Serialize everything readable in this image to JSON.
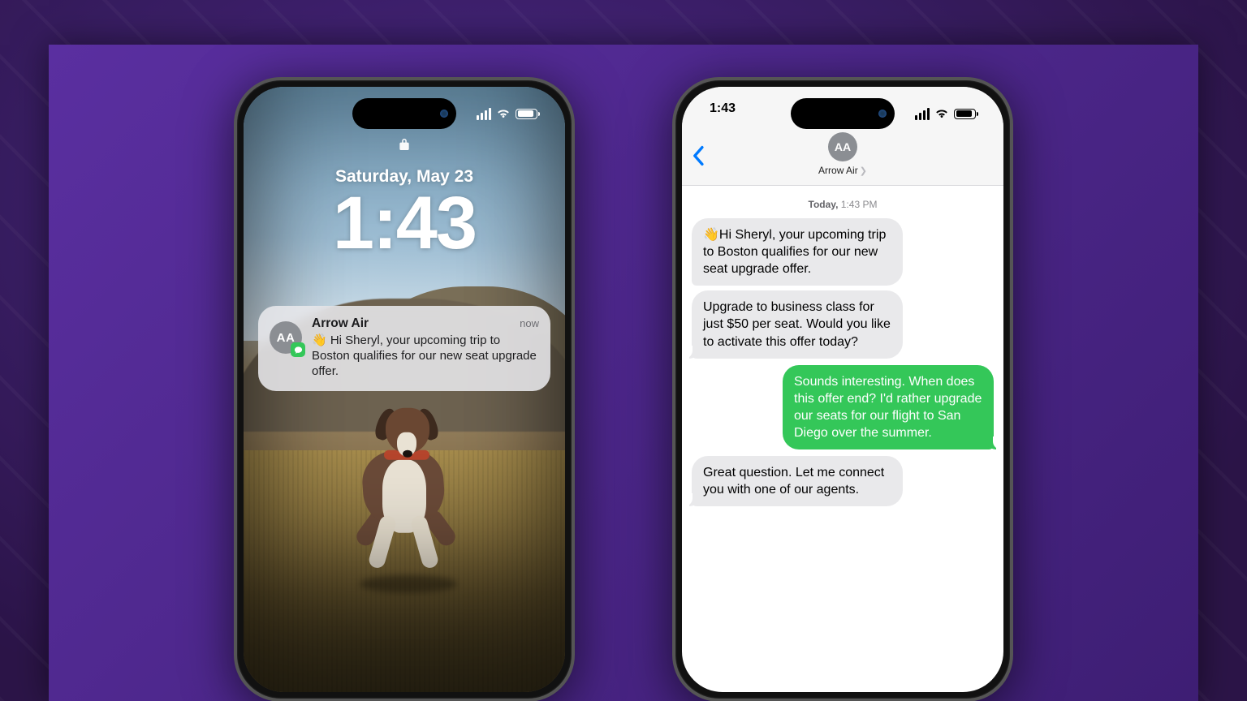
{
  "status_time": "1:43",
  "lock": {
    "date": "Saturday, May 23",
    "time": "1:43",
    "notification": {
      "app_initials": "AA",
      "app_name": "Arrow Air",
      "when": "now",
      "body": "👋 Hi Sheryl, your upcoming trip to Boston qualifies for our new seat upgrade offer."
    }
  },
  "messages": {
    "contact_initials": "AA",
    "contact_name": "Arrow Air",
    "timestamp_prefix": "Today,",
    "timestamp_time": " 1:43 PM",
    "thread": [
      {
        "dir": "in",
        "text": "👋Hi Sheryl, your upcoming trip to Boston qualifies for our new seat upgrade offer."
      },
      {
        "dir": "in",
        "text": "Upgrade to business class for just $50 per seat. Would you like to activate this offer today?"
      },
      {
        "dir": "out",
        "text": "Sounds interesting. When does this offer end? I'd rather upgrade our seats for our flight to San Diego over the summer."
      },
      {
        "dir": "in",
        "text": "Great question. Let me connect you with one of our agents."
      }
    ]
  }
}
